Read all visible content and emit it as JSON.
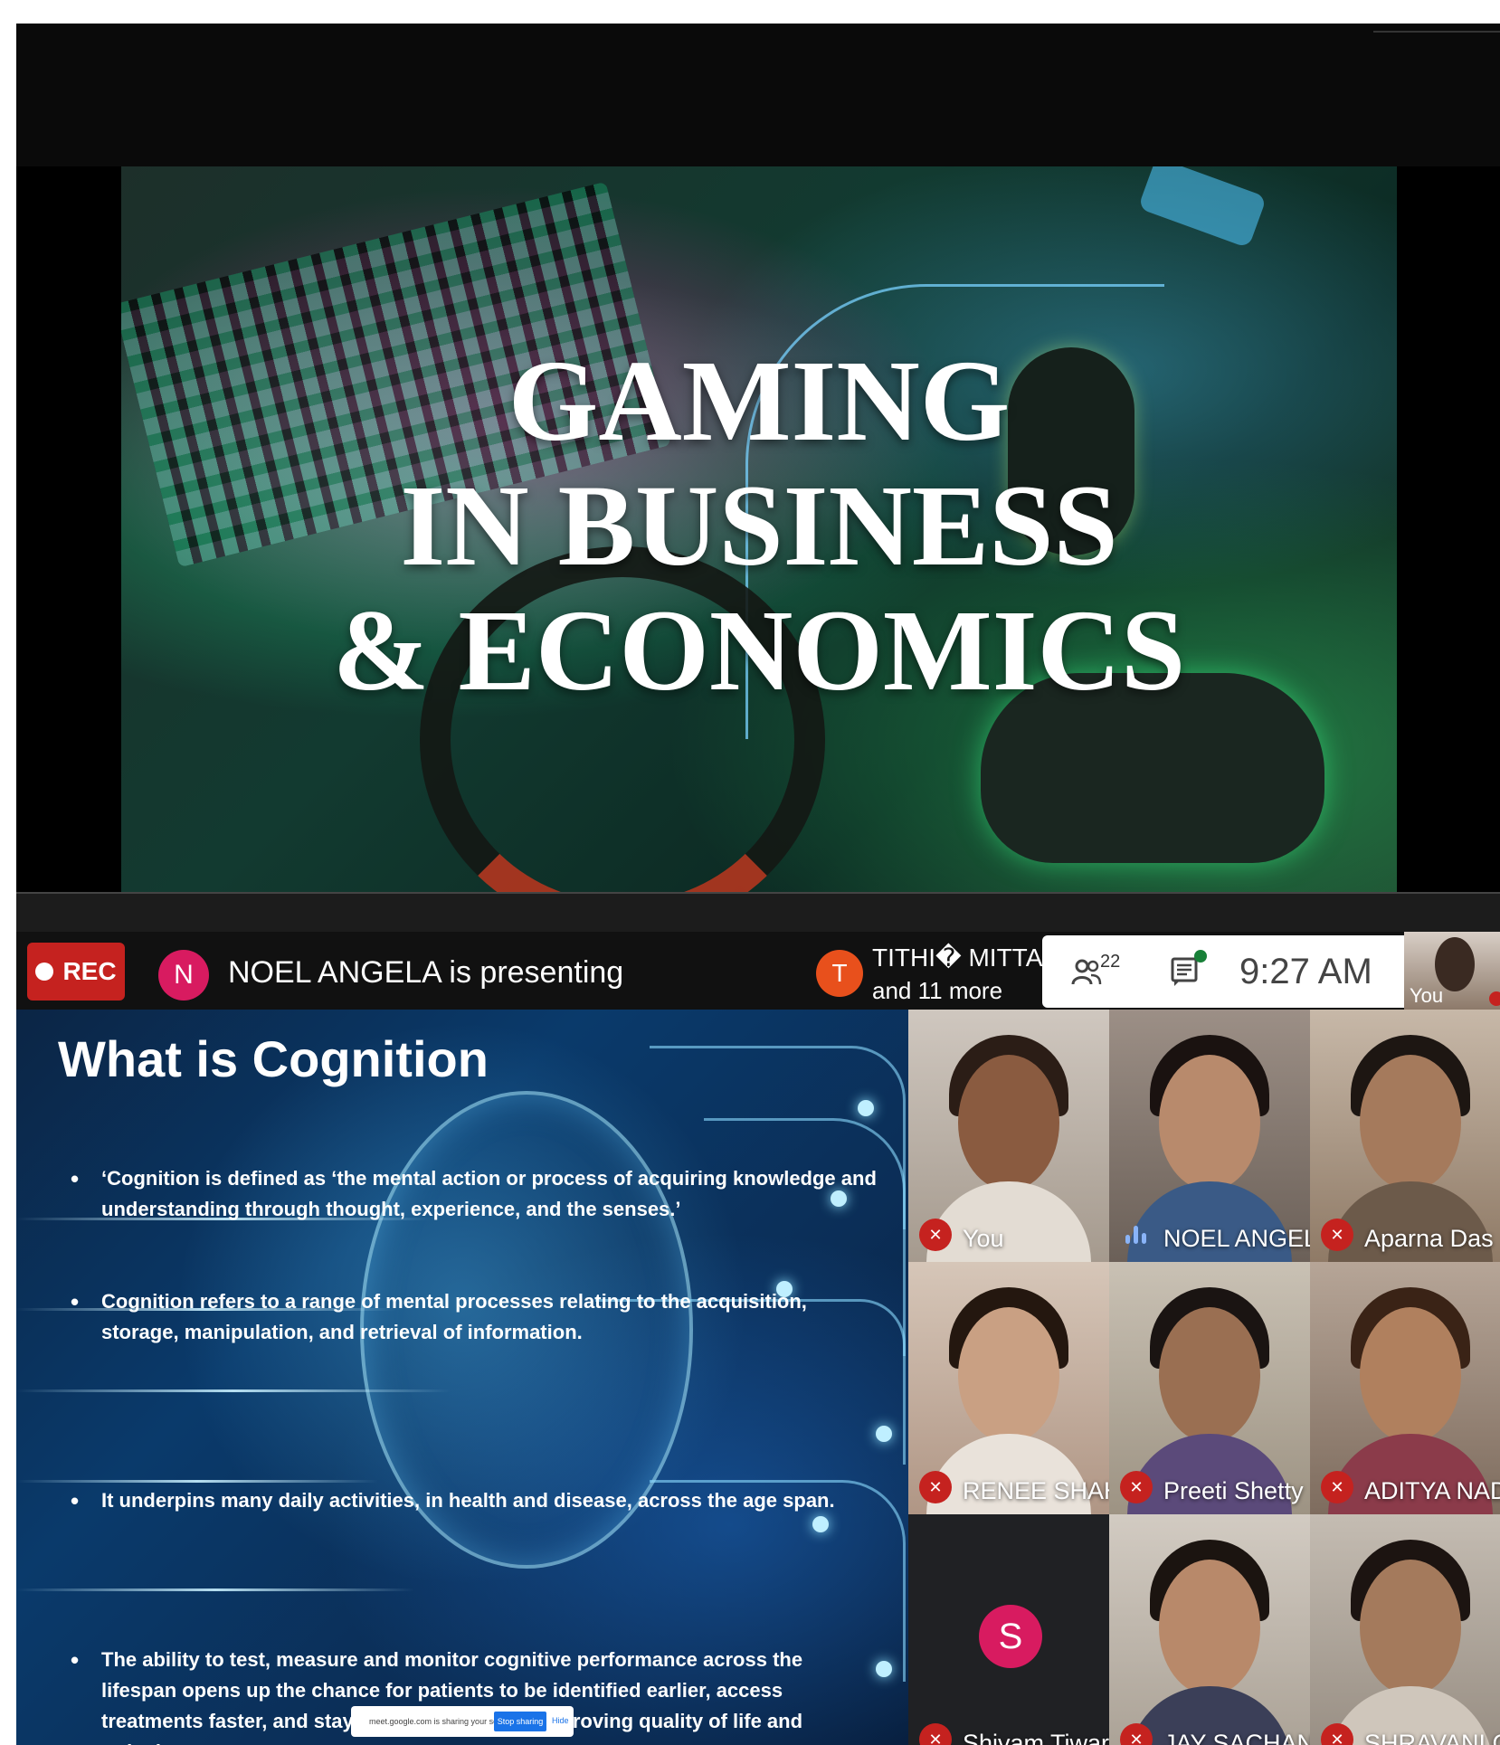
{
  "slide1": {
    "title_lines": [
      "GAMING",
      "IN BUSINESS",
      "& ECONOMICS"
    ]
  },
  "meeting_bar": {
    "rec_label": "REC",
    "presenter_initial": "N",
    "presenting_text": "NOEL ANGELA is presenting",
    "chat_initial": "T",
    "chat_name": "TITHI� MITTAL",
    "chat_more": "and 11 more",
    "participants_count": "22",
    "participants_icon": "people-icon",
    "chat_icon": "chat-icon",
    "time": "9:27 AM",
    "self_label": "You"
  },
  "slide2": {
    "title": "What is Cognition",
    "bullets": [
      "‘Cognition is defined as ‘the mental action or process of acquiring knowledge and understanding through thought, experience, and the senses.’",
      "Cognition refers to a range of mental processes relating to the acquisition, storage, manipulation, and retrieval of information.",
      "It underpins many daily activities, in health and disease, across the age span.",
      "The ability to test, measure and monitor cognitive performance across the lifespan opens up the chance for patients to be identified earlier, access treatments faster, and stay healthy for longer, improving quality of life and reducing costs."
    ],
    "sharing_bar": {
      "text": "meet.google.com is sharing your screen.",
      "stop_label": "Stop sharing",
      "hide_label": "Hide"
    }
  },
  "participants": [
    {
      "name": "You",
      "muted": true
    },
    {
      "name": "NOEL ANGELA",
      "muted": false,
      "speaking": true
    },
    {
      "name": "Aparna Das",
      "muted": true
    },
    {
      "name": "RENEE SHAH",
      "muted": true
    },
    {
      "name": "Preeti Shetty",
      "muted": true
    },
    {
      "name": "ADITYA NADAR",
      "muted": true
    },
    {
      "name": "Shivam Tiwari",
      "muted": true,
      "avatar_initial": "S"
    },
    {
      "name": "JAY SACHAN...",
      "muted": true
    },
    {
      "name": "SHRAVANI G...",
      "muted": true
    }
  ],
  "colors": {
    "rec": "#c5221f",
    "presenter_avatar": "#d81b60",
    "chat_avatar": "#e8501c",
    "mic_muted": "#c5221f",
    "speaking": "#8ab4f8",
    "chat_dot": "#188038"
  }
}
